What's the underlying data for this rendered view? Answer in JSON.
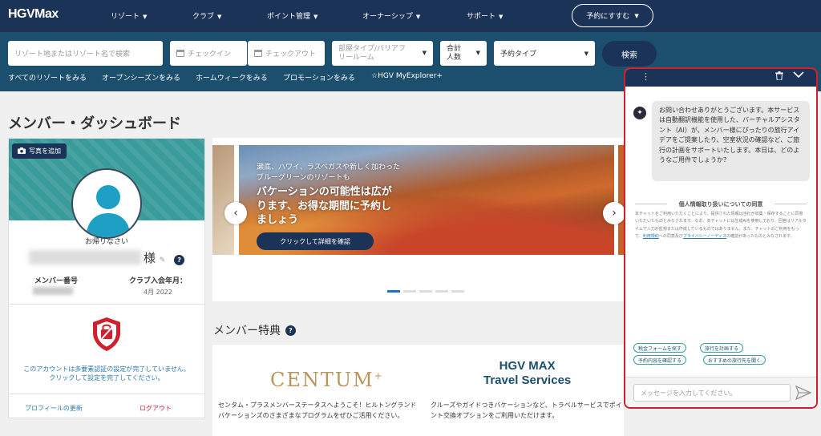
{
  "nav": {
    "logo": "HGVMax",
    "items": [
      "リゾート",
      "クラブ",
      "ポイント管理",
      "オーナーシップ",
      "サポート"
    ],
    "reserve": "予約にすすむ"
  },
  "search": {
    "resort_placeholder": "リゾート地またはリゾート名で検索",
    "checkin": "チェックイン",
    "checkout": "チェックアウト",
    "room_type_line1": "部屋タイプ/バリアフ",
    "room_type_line2": "リールーム",
    "guests_line1": "合計",
    "guests_line2": "人数",
    "booking_type": "予約タイプ",
    "button": "検索"
  },
  "sublinks": [
    "すべてのリゾートをみる",
    "オープンシーズンをみる",
    "ホームウィークをみる",
    "プロモーションをみる",
    "☆HGV MyExplorer+"
  ],
  "dashboard": {
    "title": "メンバー・ダッシュボード",
    "add_photo": "写真を追加",
    "greeting": "お帰りなさい",
    "honorific": "様",
    "member_number_label": "メンバー番号",
    "join_date_label": "クラブ入会年月：",
    "join_date_value": "4月 2022",
    "mfa_line1": "このアカウントは多要素認証の設定が完了していません。",
    "mfa_line2": "クリックして設定を完了してください。",
    "profile_update": "プロフィールの更新",
    "logout": "ログアウト"
  },
  "carousel": {
    "subtext": "瀬底、ハワイ、ラスベガスや新しく加わったブルーグリーンのリゾートも",
    "headline": "バケーションの可能性は広がります、お得な期間に予約しましょう",
    "cta": "クリックして詳細を確認",
    "slide_count": 5,
    "active_index": 0
  },
  "benefits": {
    "title": "メンバー特典",
    "centum": "CENTUM",
    "travel_line1": "HGV MAX",
    "travel_line2": "Travel Services",
    "desc_left": "センタム・プラスメンバーステータスへようこそ！ヒルトングランドバケーションズのさまざまなプログラムをぜひご活用ください。",
    "desc_right": "クルーズやガイドつきバケーションなど、トラベルサービスでポイント交換オプションをご利用いただけます。"
  },
  "chat": {
    "greeting": "お問い合わせありがとうございます。本サービスは自動翻訳機能を使用した、バーチャルアシスタント（AI）が、メンバー様にぴったりの旅行アイデアをご提案したり、空室状況の確認など、ご旅行の計画をサポートいたします。本日は、どのようなご用件でしょうか？",
    "privacy_title": "個人情報取り扱いについての同意",
    "privacy_text_1": "本チャットをご利用いただくことにより、提供された情報は当社が収集・保存することに同意いただいたものとみなされます。なお、本チャットには生成AIを使用しており、回答はリアルタイムで入力が監視または作成しているものではありません。また、チャットのご利用をもって、",
    "privacy_link_1": "利用規約",
    "privacy_text_2": "への同意及び",
    "privacy_link_2": "プライバシーノーティス",
    "privacy_text_3": "の確認があったものとみなされます。",
    "quick_replies": [
      "税金フォームを探す",
      "旅行を計画する",
      "予約内容を確認する",
      "おすすめの旅行先を聞く"
    ],
    "input_placeholder": "メッセージを入力してください。"
  }
}
